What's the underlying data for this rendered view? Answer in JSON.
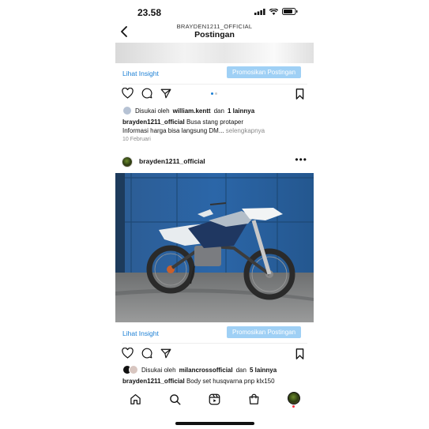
{
  "status": {
    "time": "23.58"
  },
  "header": {
    "username": "BRAYDEN1211_OFFICIAL",
    "title": "Postingan"
  },
  "post1": {
    "insight_label": "Lihat Insight",
    "promote_label": "Promosikan Postingan",
    "liked_prefix": "Disukai oleh",
    "liked_user": "william.kentt",
    "liked_and": "dan",
    "liked_others": "1 lainnya",
    "caption_user": "brayden1211_official",
    "caption_text": "Busa stang protaper",
    "caption_line2": "Informasi harga bisa langsung DM...",
    "more_label": "selengkapnya",
    "date": "10 Februari",
    "carousel_index": 1,
    "carousel_count": 2
  },
  "post2": {
    "username": "brayden1211_official",
    "insight_label": "Lihat Insight",
    "promote_label": "Promosikan Postingan",
    "liked_prefix": "Disukai oleh",
    "liked_user": "milancrossofficial",
    "liked_and": "dan",
    "liked_others": "5 lainnya",
    "caption_user": "brayden1211_official",
    "caption_text": "Body set husqvarna pnp klx150"
  },
  "tabbar": {
    "items": [
      "home-icon",
      "search-icon",
      "reels-icon",
      "shop-icon",
      "profile-avatar"
    ]
  },
  "colors": {
    "accent": "#1b7fd4",
    "promote_bg": "#9fd0f5",
    "notification_dot": "#ff3040"
  }
}
